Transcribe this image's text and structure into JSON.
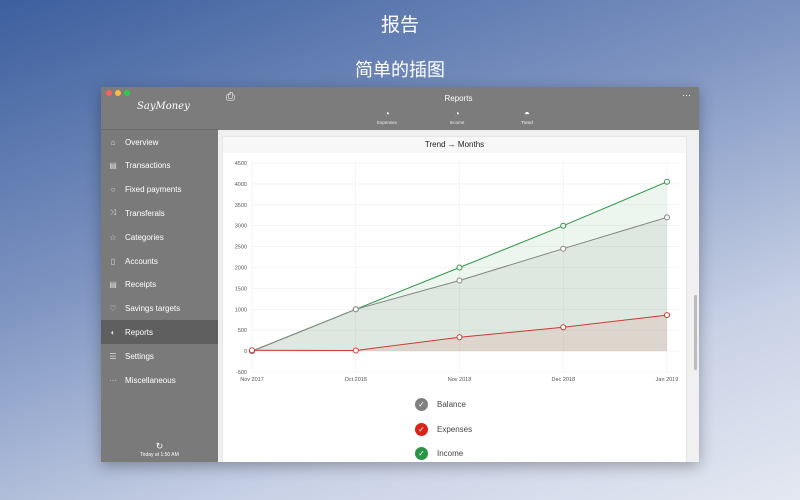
{
  "headline": "报告",
  "subheadline": "简单的插图",
  "app": {
    "logo": "SayMoney",
    "title": "Reports",
    "sync": "Today at 1:50 AM"
  },
  "sidebar": [
    {
      "label": "Overview",
      "icon": "⌂"
    },
    {
      "label": "Transactions",
      "icon": "▤"
    },
    {
      "label": "Fixed payments",
      "icon": "○"
    },
    {
      "label": "Transferals",
      "icon": "⤨"
    },
    {
      "label": "Categories",
      "icon": "☆"
    },
    {
      "label": "Accounts",
      "icon": "▯"
    },
    {
      "label": "Receipts",
      "icon": "▤"
    },
    {
      "label": "Savings targets",
      "icon": "♡"
    },
    {
      "label": "Reports",
      "icon": "◐",
      "active": true
    },
    {
      "label": "Settings",
      "icon": "☰"
    },
    {
      "label": "Miscellaneous",
      "icon": "···"
    }
  ],
  "tabs": [
    {
      "label": "Expenses"
    },
    {
      "label": "Income"
    },
    {
      "label": "Trend"
    }
  ],
  "chart_data": {
    "type": "area",
    "title": "Trend → Months",
    "categories": [
      "Nov 2017",
      "Oct 2018",
      "Nov 2018",
      "Dec 2018",
      "Jan 2019"
    ],
    "ylim": [
      -500,
      4500
    ],
    "yticks": [
      -500,
      0,
      500,
      1000,
      1500,
      2000,
      2500,
      3000,
      3500,
      4000,
      4500
    ],
    "grid": true,
    "series": [
      {
        "name": "Income",
        "color": "#2e9447",
        "values": [
          0,
          1000,
          2000,
          3000,
          4050
        ]
      },
      {
        "name": "Balance",
        "color": "#858585",
        "values": [
          0,
          1000,
          1690,
          2450,
          3200
        ]
      },
      {
        "name": "Expenses",
        "color": "#cc3b30",
        "values": [
          20,
          15,
          330,
          570,
          860
        ]
      }
    ],
    "legend": [
      {
        "name": "Balance",
        "color": "#808080"
      },
      {
        "name": "Expenses",
        "color": "#d9241c"
      },
      {
        "name": "Income",
        "color": "#2a9446"
      }
    ]
  }
}
